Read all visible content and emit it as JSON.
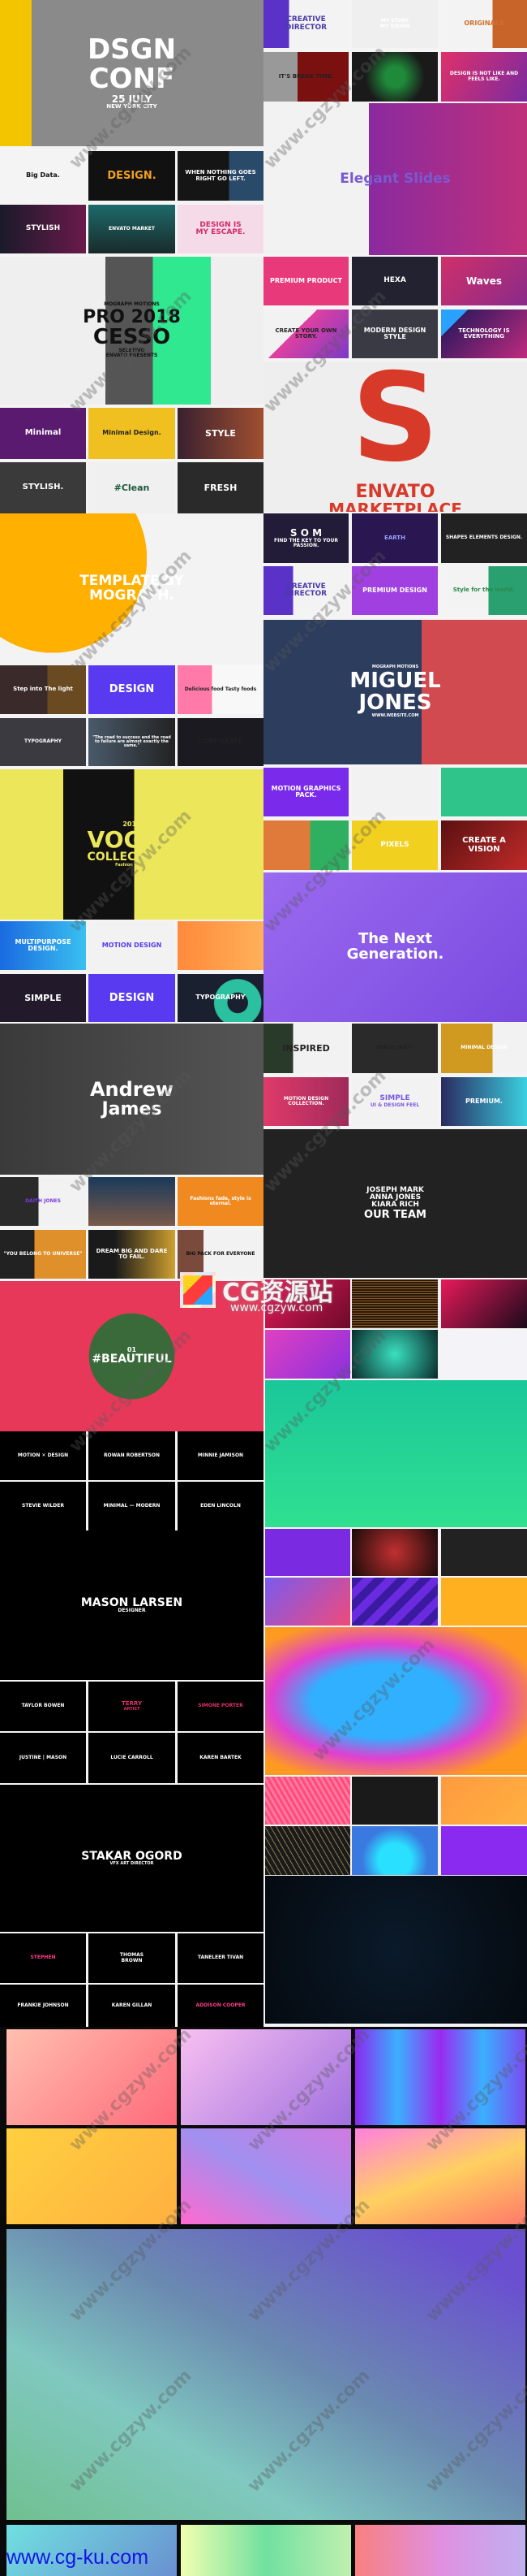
{
  "watermark": {
    "site": "www.cgzyw.com",
    "logo": "CG资源站",
    "footer_site": "www.cg-ku.com"
  },
  "tiles": {
    "dsgn_conf": [
      "DSGN",
      "CONF",
      "25 JULY",
      "NEW YORK CITY"
    ],
    "creative_director": [
      "CREATIVE",
      "DIRECTOR"
    ],
    "my_story": [
      "MY STORY",
      "MY VISION"
    ],
    "originals": [
      "ORIGINALS"
    ],
    "break_time": [
      "IT'S BREAK TIME."
    ],
    "green_leaf": [],
    "design_not_like": [
      "DESIGN IS NOT LIKE AND FEELS LIKE."
    ],
    "elegant_slides": [
      "Elegant Slides"
    ],
    "big_data": [
      "Big Data."
    ],
    "design_black": [
      "DESIGN."
    ],
    "when_nothing": [
      "WHEN NOTHING GOES RIGHT GO LEFT."
    ],
    "stylish": [
      "STYLISH"
    ],
    "envato_market": [
      "ENVATO MARKET"
    ],
    "design_escape": [
      "DESIGN IS",
      "MY ESCAPE."
    ],
    "pro_cesso": [
      "MOGRAPH MOTIONS",
      "PRO 2018",
      "CESSO",
      "SELETIVO",
      "ENVATO PRESENTS"
    ],
    "premium_product": [
      "PREMIUM PRODUCT"
    ],
    "hexa": [
      "HEXA"
    ],
    "waves": [
      "Waves"
    ],
    "create_story": [
      "CREATE YOUR OWN STORY."
    ],
    "modern_design": [
      "MODERN DESIGN",
      "STYLE"
    ],
    "technology": [
      "TECHNOLOGY IS EVERYTHING"
    ],
    "envato_s": [
      "S",
      "ENVATO",
      "MARKETPLACE"
    ],
    "minimal": [
      "Minimal"
    ],
    "minimal_design": [
      "Minimal Design."
    ],
    "style": [
      "STYLE"
    ],
    "stylish2": [
      "STYLISH."
    ],
    "clean": [
      "#Clean"
    ],
    "fresh": [
      "FRESH"
    ],
    "template_mograph": [
      "TEMPLATE BY",
      "MOGRAPH."
    ],
    "som": [
      "S O M",
      "FIND THE KEY TO YOUR PASSION."
    ],
    "earth": [
      "EARTH"
    ],
    "shapes": [
      "SHAPES ELEMENTS DESIGN."
    ],
    "creative_director2": [
      "CREATIVE",
      "DIRECTOR"
    ],
    "premium_design": [
      "PREMIUM DESIGN"
    ],
    "style_world": [
      "Style for the world."
    ],
    "step_light": [
      "Step into The light"
    ],
    "design_purple": [
      "DESIGN"
    ],
    "delicious": [
      "Delicious food Tasty foods"
    ],
    "typography": [
      "TYPOGRAPHY"
    ],
    "road_success": [
      "\"The road to success and the road to failure are almost exactly the same.\""
    ],
    "corporate": [
      "CORPORATE"
    ],
    "miguel_jones": [
      "MOGRAPH MOTIONS",
      "MIGUEL",
      "JONES",
      "WWW.WEBSITE.COM"
    ],
    "motion_graphics": [
      "MOTION GRAPHICS PACK."
    ],
    "profile": [],
    "green_title": [],
    "mountains": [],
    "pixels": [
      "PIXELS"
    ],
    "create_vision": [
      "CREATE A",
      "VISION"
    ],
    "next_generation": [
      "The Next",
      "Generation."
    ],
    "vogue": [
      "2018",
      "VOGUE",
      "COLLECTION+",
      "Fashion trend."
    ],
    "multipurpose": [
      "MULTIPURPOSE DESIGN."
    ],
    "motion_design": [
      "MOTION DESIGN"
    ],
    "orange_iso": [],
    "simple": [
      "SIMPLE"
    ],
    "design3": [
      "DESIGN"
    ],
    "typography2": [
      "TYPOGRAPHY"
    ],
    "andrew_james": [
      "Andrew",
      "James"
    ],
    "inspired": [
      "INSPIRED"
    ],
    "beach_party": [
      "BEACH PARTY"
    ],
    "minimal_design2": [
      "MINIMAL DESIGN"
    ],
    "run": [
      "MOTION DESIGN COLLECTION."
    ],
    "simple_ui": [
      "SIMPLE",
      "UI & DESIGN FEEL"
    ],
    "premium2": [
      "PREMIUM."
    ],
    "our_team": [
      "JOSEPH MARK",
      "ANNA JONES",
      "KIARA RICH",
      "OUR TEAM"
    ],
    "daith": [
      "DAITH JONES"
    ],
    "landscape": [],
    "fashion_fade": [
      "Fashions fade, style is eternal."
    ],
    "you_belong": [
      "\"YOU BELONG TO UNIVERSE\""
    ],
    "dream_big": [
      "DREAM BIG AND DARE TO FAIL."
    ],
    "big_pack": [
      "BIG PACK FOR EVERYONE"
    ],
    "beautiful": [
      "01",
      "#BEAUTIFUL"
    ],
    "motion_x_design": [
      "MOTION ✕ DESIGN"
    ],
    "rowan": [
      "ROWAN ROBERTSON"
    ],
    "minnie": [
      "MINNIE JAMISON"
    ],
    "stevie": [
      "STEVIE WILDER"
    ],
    "minimal_modern": [
      "MINIMAL — MODERN"
    ],
    "eden": [
      "EDEN LINCOLN"
    ],
    "mason": [
      "MASON LARSEN",
      "DESIGNER"
    ],
    "taylor": [
      "TAYLOR BOWEN"
    ],
    "terry": [
      "TERRY",
      "ARTIST"
    ],
    "simone": [
      "SIMONE PORTER"
    ],
    "justine": [
      "JUSTINE | MASON"
    ],
    "lucie": [
      "LUCIE CARROLL"
    ],
    "karen_b": [
      "KAREN BARTEK"
    ],
    "stakar": [
      "STAKAR OGORD",
      "VFX ART DIRECTOR"
    ],
    "stephen": [
      "STEPHEN"
    ],
    "thomas": [
      "THOMAS",
      "BROWN"
    ],
    "taneleer": [
      "TANELEER TIVAN"
    ],
    "frankie": [
      "FRANKIE JOHNSON"
    ],
    "karen_g": [
      "KAREN GILLAN"
    ],
    "addison": [
      "ADDISON COOPER"
    ]
  }
}
